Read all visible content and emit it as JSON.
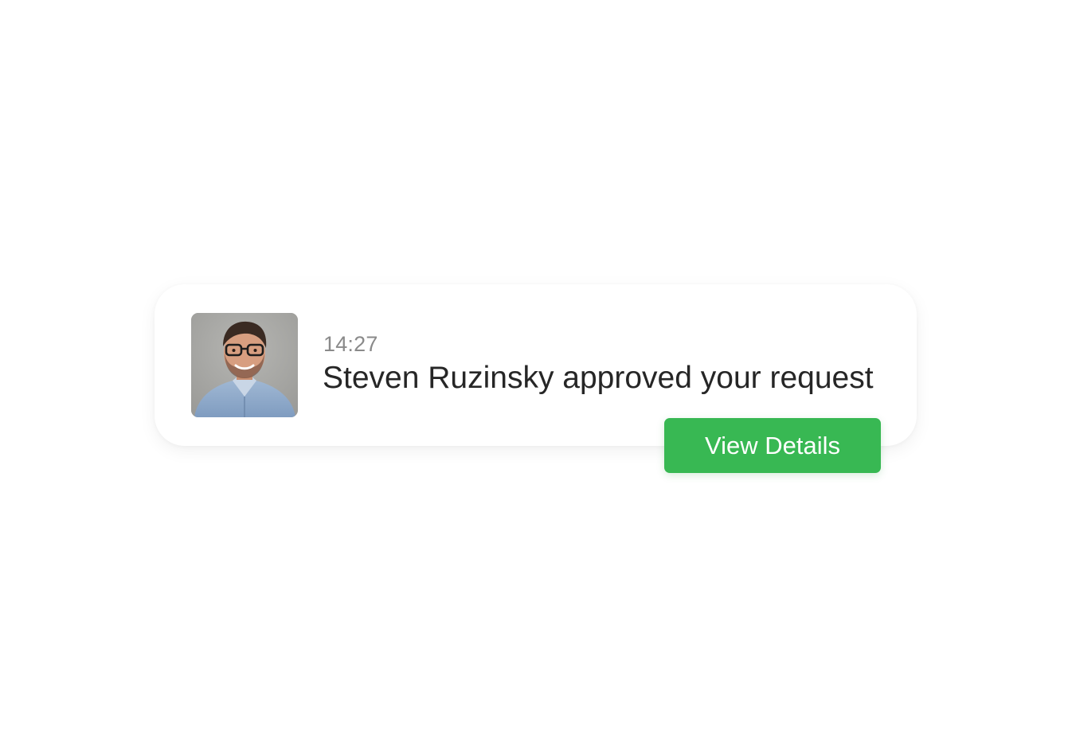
{
  "notification": {
    "time": "14:27",
    "message": "Steven Ruzinsky approved your request",
    "avatar_icon": "user-avatar-photo",
    "button_label": "View Details"
  },
  "colors": {
    "button_background": "#38b853",
    "button_text": "#ffffff",
    "message_text": "#262626",
    "time_text": "#8a8a8a",
    "card_background": "#ffffff"
  }
}
